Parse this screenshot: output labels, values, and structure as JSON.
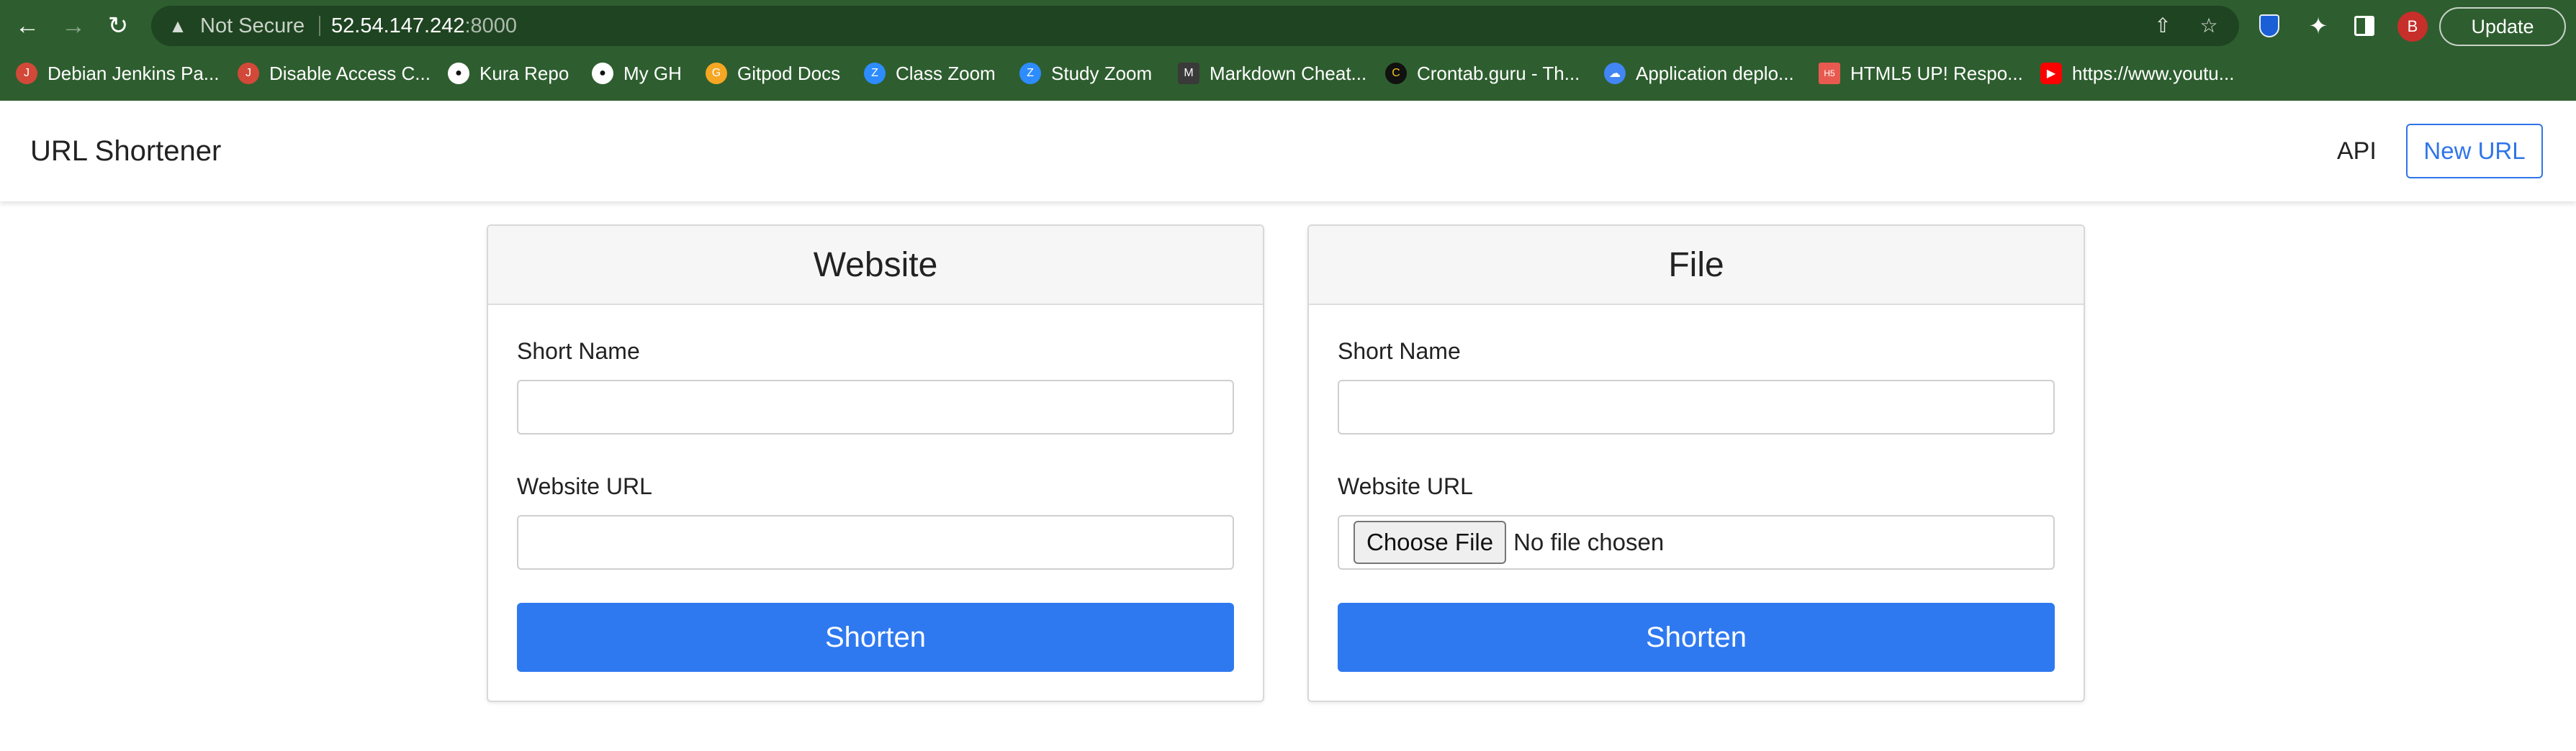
{
  "browser": {
    "security_label": "Not Secure",
    "url_host": "52.54.147.242",
    "url_port": ":8000",
    "update_label": "Update",
    "profile_initial": "B"
  },
  "bookmarks": [
    {
      "label": "Debian Jenkins Pa...",
      "icon": "jenkins-icon",
      "color": "#d24939"
    },
    {
      "label": "Disable Access C...",
      "icon": "jenkins-icon",
      "color": "#d24939"
    },
    {
      "label": "Kura Repo",
      "icon": "github-icon",
      "color": "#ffffff"
    },
    {
      "label": "My GH",
      "icon": "github-icon",
      "color": "#ffffff"
    },
    {
      "label": "Gitpod Docs",
      "icon": "gitpod-icon",
      "color": "#f5a623"
    },
    {
      "label": "Class Zoom",
      "icon": "zoom-icon",
      "color": "#2d8cff"
    },
    {
      "label": "Study Zoom",
      "icon": "zoom-icon",
      "color": "#2d8cff"
    },
    {
      "label": "Markdown Cheat...",
      "icon": "markdown-icon",
      "color": "#3a3a3a"
    },
    {
      "label": "Crontab.guru - Th...",
      "icon": "crontab-icon",
      "color": "#111111"
    },
    {
      "label": "Application deplo...",
      "icon": "gcp-icon",
      "color": "#4285f4"
    },
    {
      "label": "HTML5 UP! Respo...",
      "icon": "html5up-icon",
      "color": "#e85a4f"
    },
    {
      "label": "https://www.youtu...",
      "icon": "youtube-icon",
      "color": "#ff0000"
    }
  ],
  "app": {
    "brand": "URL Shortener",
    "nav_api": "API",
    "nav_new_url": "New URL"
  },
  "website_card": {
    "title": "Website",
    "short_name_label": "Short Name",
    "short_name_value": "",
    "url_label": "Website URL",
    "url_value": "",
    "submit_label": "Shorten"
  },
  "file_card": {
    "title": "File",
    "short_name_label": "Short Name",
    "short_name_value": "",
    "file_label": "Website URL",
    "choose_label": "Choose File",
    "no_file_text": "No file chosen",
    "submit_label": "Shorten"
  },
  "colors": {
    "chrome_bg": "#2e5e2f",
    "primary": "#2f79f0",
    "outline": "#2f75e8"
  }
}
